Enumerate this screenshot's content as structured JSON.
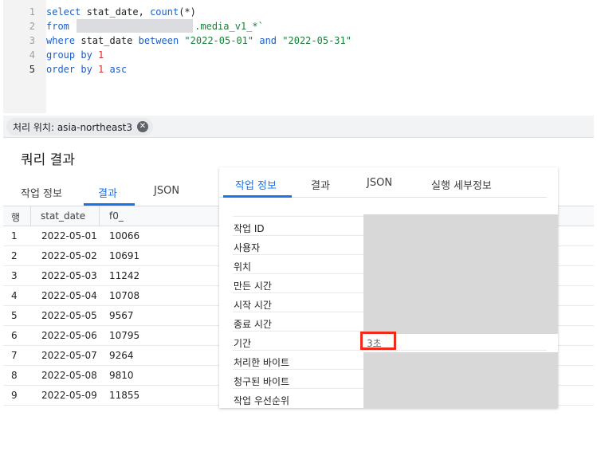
{
  "editor": {
    "lines": [
      {
        "n": "1",
        "tokens": [
          [
            "kw",
            "select"
          ],
          [
            "pl",
            " stat_date, "
          ],
          [
            "fn",
            "count"
          ],
          [
            "pl",
            "(*)"
          ]
        ]
      },
      {
        "n": "2",
        "tokens": [
          [
            "kw",
            "from"
          ],
          [
            "pl",
            " "
          ],
          [
            "redact",
            ""
          ],
          [
            "str",
            ".media_v1_*`"
          ]
        ]
      },
      {
        "n": "3",
        "tokens": [
          [
            "kw",
            "where"
          ],
          [
            "pl",
            " stat_date "
          ],
          [
            "kw",
            "between"
          ],
          [
            "pl",
            " "
          ],
          [
            "str",
            "\"2022-05-01\""
          ],
          [
            "pl",
            " "
          ],
          [
            "kw",
            "and"
          ],
          [
            "pl",
            " "
          ],
          [
            "str",
            "\"2022-05-31\""
          ]
        ]
      },
      {
        "n": "4",
        "tokens": [
          [
            "kw",
            "group by"
          ],
          [
            "pl",
            " "
          ],
          [
            "num",
            "1"
          ]
        ]
      },
      {
        "n": "5",
        "tokens": [
          [
            "kw",
            "order by"
          ],
          [
            "pl",
            " "
          ],
          [
            "num",
            "1"
          ],
          [
            "pl",
            " "
          ],
          [
            "kw",
            "asc"
          ]
        ]
      }
    ]
  },
  "location_chip": {
    "label": "처리 위치: asia-northeast3",
    "close_icon": "close-icon"
  },
  "results": {
    "title": "쿼리 결과",
    "tabs": [
      "작업 정보",
      "결과",
      "JSON"
    ],
    "active_tab": "결과",
    "columns": [
      "행",
      "stat_date",
      "f0_"
    ],
    "rows": [
      [
        "1",
        "2022-05-01",
        "10066"
      ],
      [
        "2",
        "2022-05-02",
        "10691"
      ],
      [
        "3",
        "2022-05-03",
        "11242"
      ],
      [
        "4",
        "2022-05-04",
        "10708"
      ],
      [
        "5",
        "2022-05-05",
        "9567"
      ],
      [
        "6",
        "2022-05-06",
        "10795"
      ],
      [
        "7",
        "2022-05-07",
        "9264"
      ],
      [
        "8",
        "2022-05-08",
        "9810"
      ],
      [
        "9",
        "2022-05-09",
        "11855"
      ]
    ]
  },
  "job_info": {
    "tabs": [
      "작업 정보",
      "결과",
      "JSON",
      "실행 세부정보"
    ],
    "active_tab": "작업 정보",
    "rows": [
      {
        "label": "작업 ID",
        "value": ""
      },
      {
        "label": "사용자",
        "value": ""
      },
      {
        "label": "위치",
        "value": ""
      },
      {
        "label": "만든 시간",
        "value": ""
      },
      {
        "label": "시작 시간",
        "value": ""
      },
      {
        "label": "종료 시간",
        "value": ""
      },
      {
        "label": "기간",
        "value": "3초"
      },
      {
        "label": "처리한 바이트",
        "value": ""
      },
      {
        "label": "청구된 바이트",
        "value": ""
      },
      {
        "label": "작업 우선순위",
        "value": ""
      }
    ],
    "highlight_color": "#ef2b1c",
    "redaction_color": "#d8d8d8"
  }
}
